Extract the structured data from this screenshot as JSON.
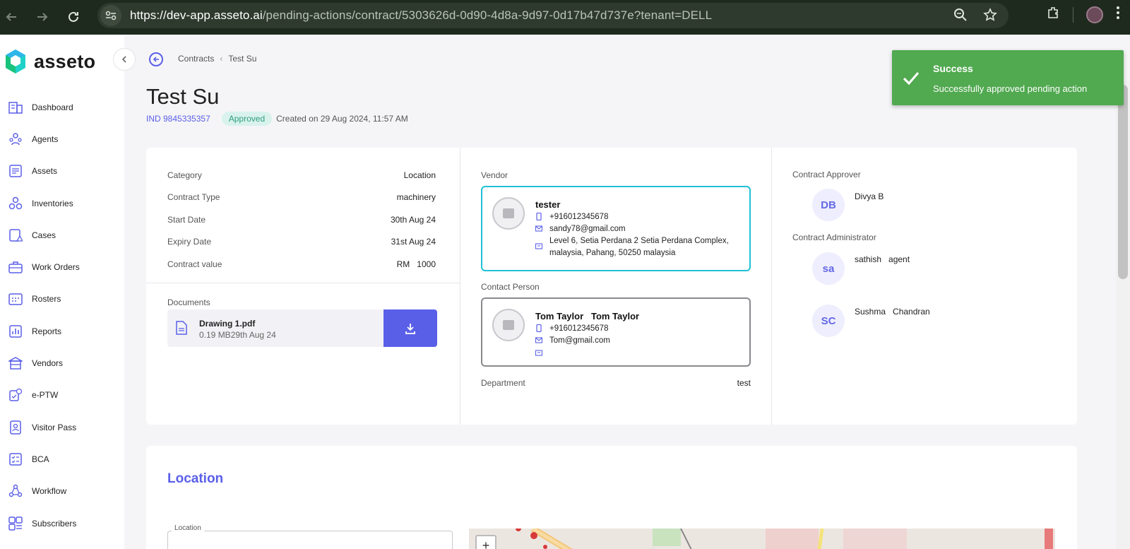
{
  "browser": {
    "url_host": "https://dev-app.asseto.ai",
    "url_path": "/pending-actions/contract/5303626d-0d90-4d8a-9d97-0d17b47d737e?tenant=DELL"
  },
  "app": {
    "logo_text": "asseto",
    "brand_color": "#5a5fe8"
  },
  "sidebar": {
    "items": [
      {
        "label": "Dashboard",
        "icon": "dashboard-icon"
      },
      {
        "label": "Agents",
        "icon": "agents-icon"
      },
      {
        "label": "Assets",
        "icon": "assets-icon"
      },
      {
        "label": "Inventories",
        "icon": "inventories-icon"
      },
      {
        "label": "Cases",
        "icon": "cases-icon"
      },
      {
        "label": "Work Orders",
        "icon": "work-orders-icon"
      },
      {
        "label": "Rosters",
        "icon": "rosters-icon"
      },
      {
        "label": "Reports",
        "icon": "reports-icon"
      },
      {
        "label": "Vendors",
        "icon": "vendors-icon"
      },
      {
        "label": "e-PTW",
        "icon": "eptw-icon"
      },
      {
        "label": "Visitor Pass",
        "icon": "visitor-pass-icon"
      },
      {
        "label": "BCA",
        "icon": "bca-icon"
      },
      {
        "label": "Workflow",
        "icon": "workflow-icon"
      },
      {
        "label": "Subscribers",
        "icon": "subscribers-icon"
      }
    ]
  },
  "breadcrumb": {
    "parent": "Contracts",
    "current": "Test Su"
  },
  "contract": {
    "title": "Test Su",
    "id": "IND 9845335357",
    "status": "Approved",
    "created": "Created on 29 Aug 2024, 11:57 AM"
  },
  "details": {
    "category_label": "Category",
    "category_value": "Location",
    "type_label": "Contract Type",
    "type_value": "machinery",
    "start_label": "Start Date",
    "start_value": "30th Aug 24",
    "expiry_label": "Expiry Date",
    "expiry_value": "31st Aug 24",
    "value_label": "Contract value",
    "value_value": "RM   1000"
  },
  "documents": {
    "label": "Documents",
    "file_name": "Drawing 1.pdf",
    "file_meta": "0.19 MB29th Aug 24"
  },
  "vendor": {
    "label": "Vendor",
    "name": "tester",
    "phone": "+916012345678",
    "email": "sandy78@gmail.com",
    "address": "Level 6, Setia Perdana 2 Setia Perdana Complex, malaysia, Pahang, 50250 malaysia"
  },
  "contact": {
    "label": "Contact Person",
    "name": "Tom Taylor   Tom Taylor",
    "phone": "+916012345678",
    "email": "Tom@gmail.com"
  },
  "department": {
    "label": "Department",
    "value": "test"
  },
  "approver": {
    "label": "Contract Approver",
    "initials": "DB",
    "name": "Divya B"
  },
  "administrator": {
    "label": "Contract Administrator",
    "people": [
      {
        "initials": "sa",
        "name": "sathish   agent"
      },
      {
        "initials": "SC",
        "name": "Sushma   Chandran"
      }
    ]
  },
  "location": {
    "title": "Location",
    "field_label": "Location"
  },
  "toast": {
    "title": "Success",
    "message": "Successfully approved pending action"
  }
}
